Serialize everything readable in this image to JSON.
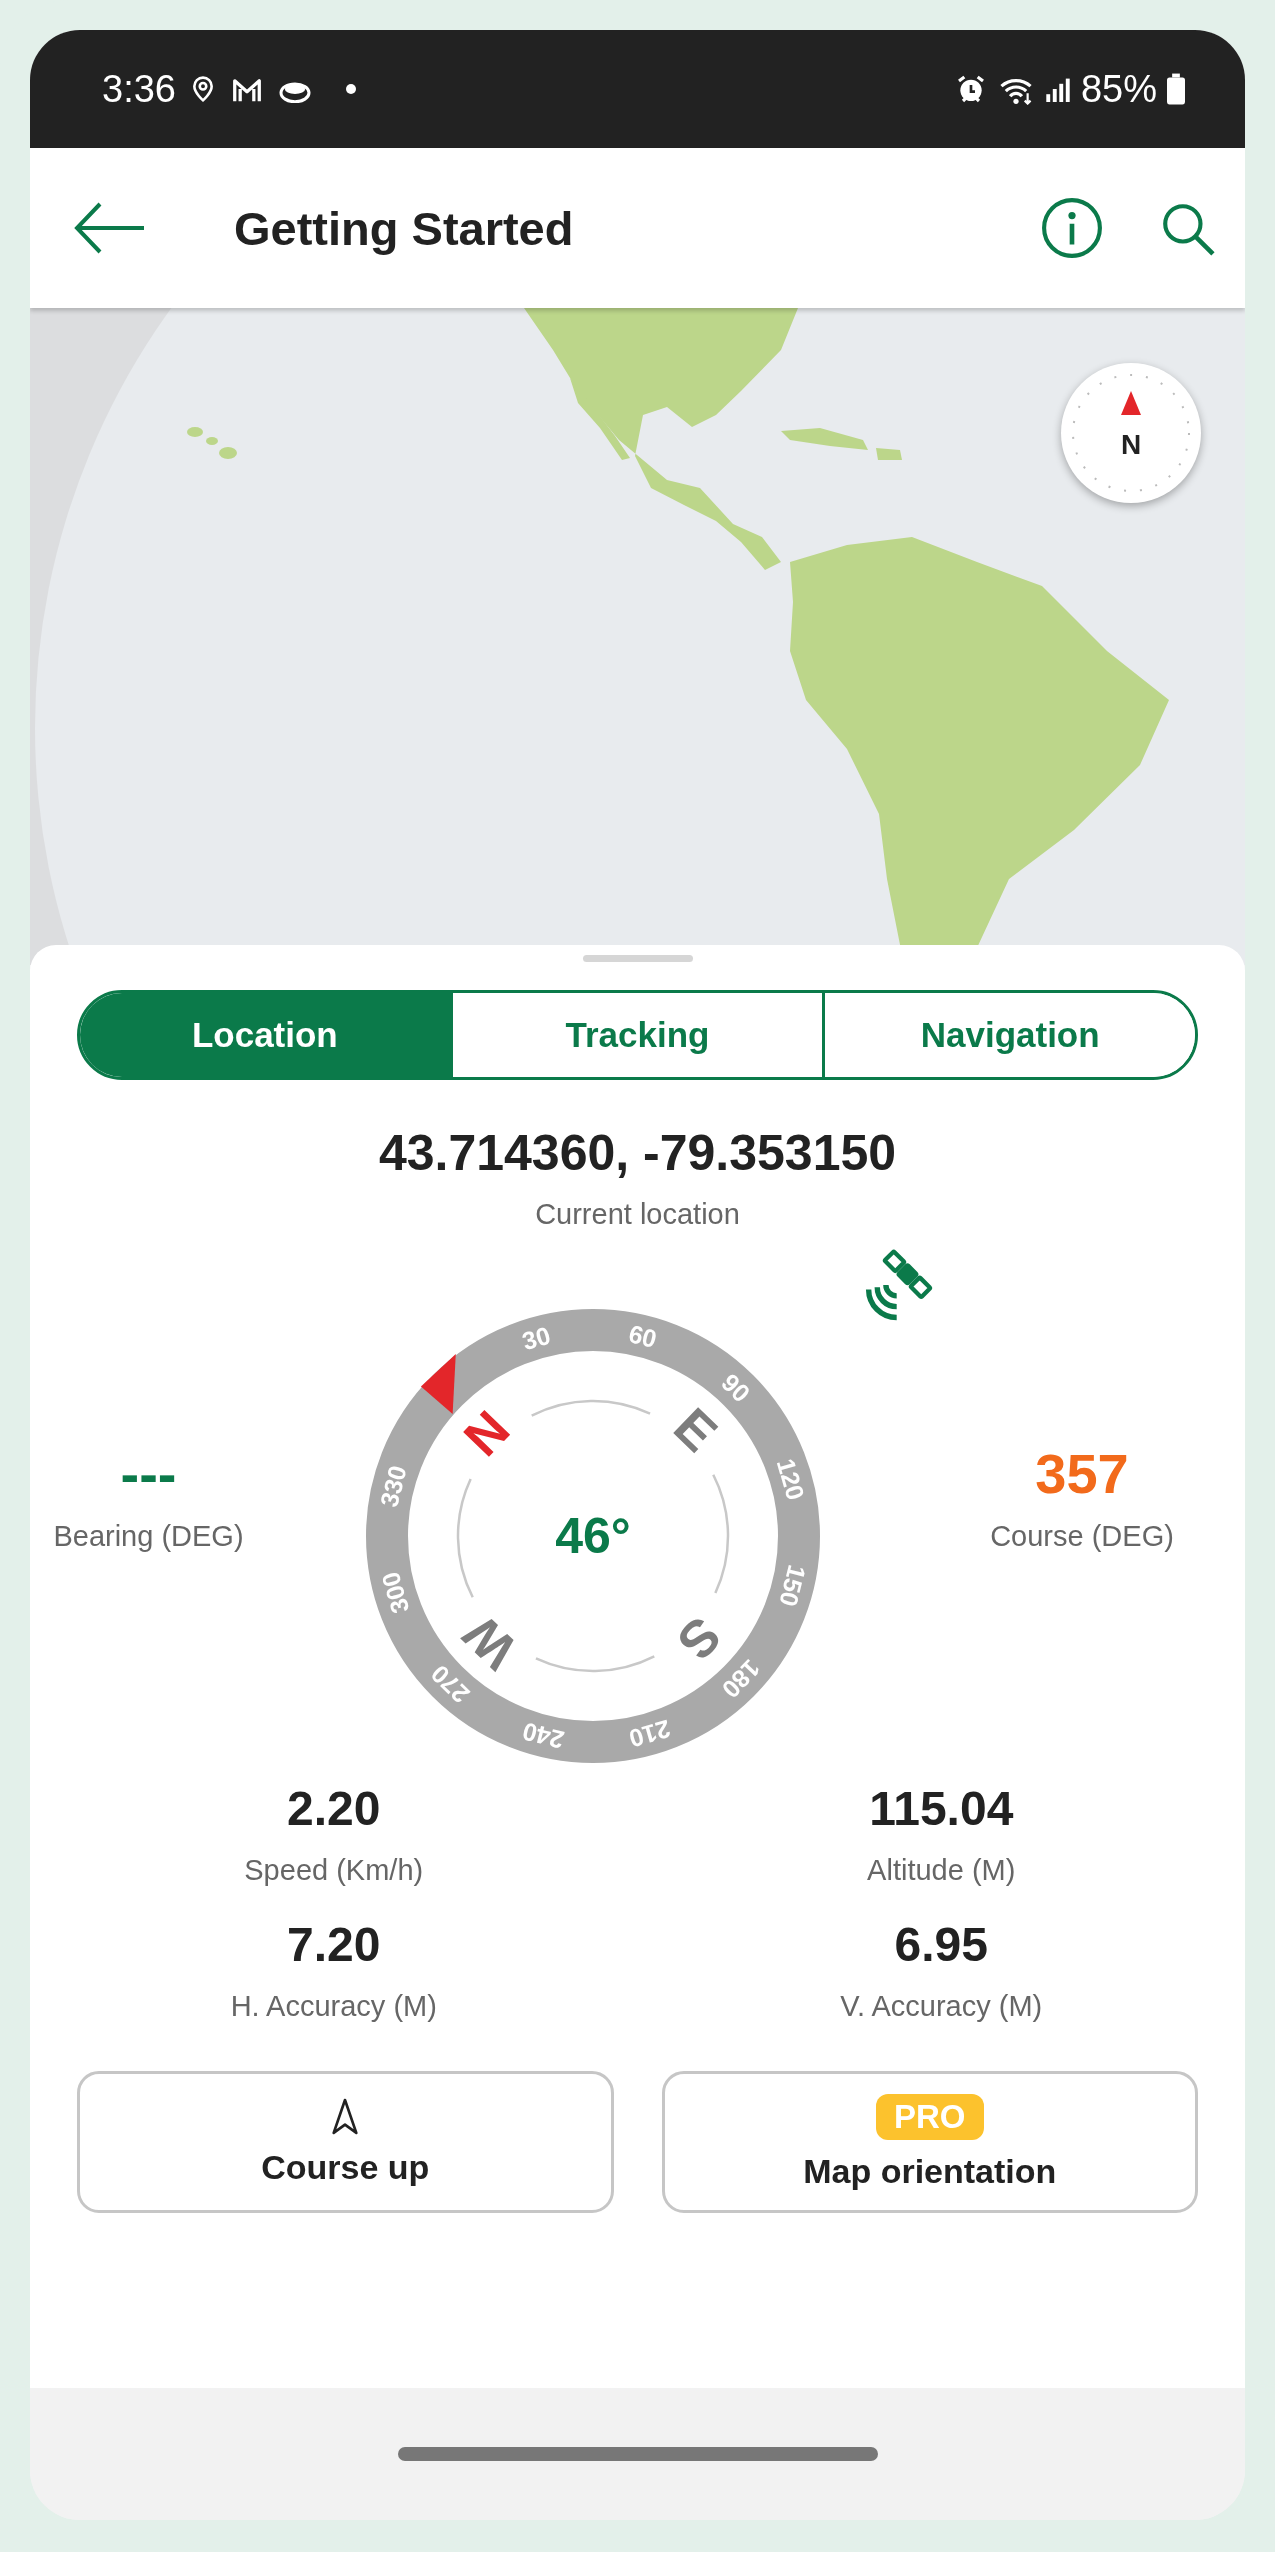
{
  "status_bar": {
    "time": "3:36",
    "battery": "85%"
  },
  "header": {
    "title": "Getting Started"
  },
  "map": {
    "kind": "picture",
    "compass_label": "N"
  },
  "tabs": [
    {
      "label": "Location",
      "selected": true
    },
    {
      "label": "Tracking",
      "selected": false
    },
    {
      "label": "Navigation",
      "selected": false
    }
  ],
  "location": {
    "value": "43.714360, -79.353150",
    "label": "Current location"
  },
  "compass": {
    "heading": "46°",
    "ring_labels": [
      "30",
      "60",
      "90",
      "120",
      "150",
      "180",
      "210",
      "240",
      "270",
      "300",
      "330"
    ],
    "cardinals": [
      {
        "label": "N",
        "color": "#e3262a"
      },
      {
        "label": "E",
        "color": "#7d7d7d"
      },
      {
        "label": "S",
        "color": "#7d7d7d"
      },
      {
        "label": "W",
        "color": "#7d7d7d"
      }
    ]
  },
  "bearing": {
    "value": "---",
    "label": "Bearing (DEG)"
  },
  "course": {
    "value": "357",
    "label": "Course (DEG)"
  },
  "stats": [
    {
      "value": "2.20",
      "label": "Speed (Km/h)"
    },
    {
      "value": "115.04",
      "label": "Altitude (M)"
    },
    {
      "value": "7.20",
      "label": "H. Accuracy (M)"
    },
    {
      "value": "6.95",
      "label": "V. Accuracy (M)"
    }
  ],
  "buttons": [
    {
      "kind": "icon",
      "label": "Course up"
    },
    {
      "kind": "badge",
      "badge": "PRO",
      "label": "Map orientation"
    }
  ]
}
